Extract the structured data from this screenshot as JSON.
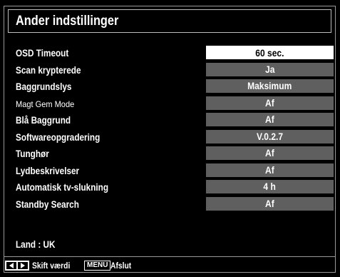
{
  "title": "Ander indstillinger",
  "rows": [
    {
      "label": "OSD Timeout",
      "value": "60 sec.",
      "selected": true
    },
    {
      "label": "Scan krypterede",
      "value": "Ja"
    },
    {
      "label": "Baggrundslys",
      "value": "Maksimum"
    },
    {
      "label": "Magt Gem Mode",
      "value": "Af"
    },
    {
      "label": "Blå Baggrund",
      "value": "Af"
    },
    {
      "label": "Softwareopgradering",
      "value": "V.0.2.7"
    },
    {
      "label": "Tunghør",
      "value": "Af"
    },
    {
      "label": "Lydbeskrivelser",
      "value": "Af"
    },
    {
      "label": "Automatisk tv-slukning",
      "value": "4 h"
    },
    {
      "label": "Standby Search",
      "value": "Af"
    }
  ],
  "arrows": {
    "left": "<",
    "right": ">"
  },
  "country": "Land : UK",
  "footer": {
    "change_label": "Skift værdi",
    "menu_key": "MENU",
    "exit_label": "Afslut"
  },
  "icons": {
    "left": "triangle-left-icon",
    "right": "triangle-right-icon"
  }
}
